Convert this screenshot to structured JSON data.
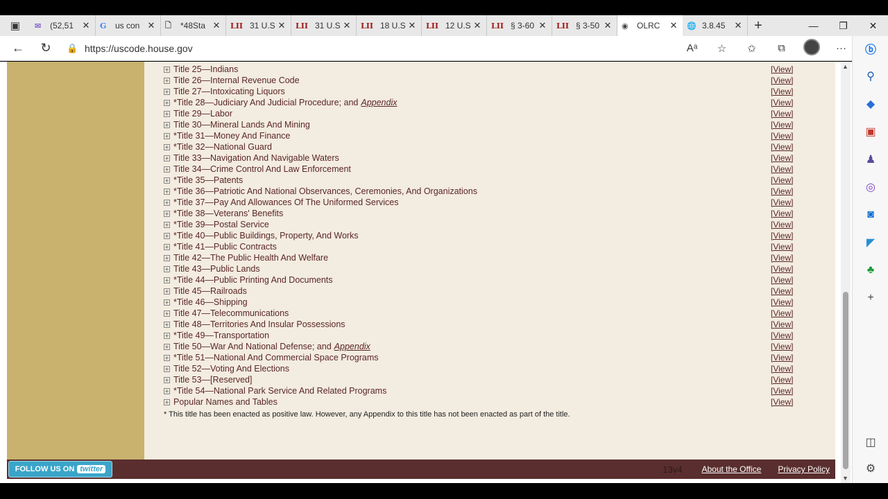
{
  "browser": {
    "tabs": [
      {
        "icon": "✉",
        "title": "(52,51",
        "kind": "mail"
      },
      {
        "icon": "G",
        "title": "us con",
        "kind": "google"
      },
      {
        "icon": "🗋",
        "title": "*48Sta",
        "kind": "doc"
      },
      {
        "icon": "LII",
        "title": "31 U.S",
        "kind": "lii"
      },
      {
        "icon": "LII",
        "title": "31 U.S",
        "kind": "lii"
      },
      {
        "icon": "LII",
        "title": "18 U.S",
        "kind": "lii"
      },
      {
        "icon": "LII",
        "title": "12 U.S",
        "kind": "lii"
      },
      {
        "icon": "LII",
        "title": "§ 3-60",
        "kind": "lii"
      },
      {
        "icon": "LII",
        "title": "§ 3-50",
        "kind": "lii"
      },
      {
        "icon": "◉",
        "title": "OLRC",
        "kind": "active"
      },
      {
        "icon": "🌐",
        "title": "3.8.45",
        "kind": "web"
      }
    ],
    "new_tab": "+",
    "url": "https://uscode.house.gov"
  },
  "titles": [
    {
      "name": "Title 25—Indians",
      "view": "[View]"
    },
    {
      "name": "Title 26—Internal Revenue Code",
      "view": "[View]"
    },
    {
      "name": "Title 27—Intoxicating Liquors",
      "view": "[View]"
    },
    {
      "name": "*Title 28—Judiciary And Judicial Procedure; and",
      "appendix": "Appendix",
      "view": "[View]"
    },
    {
      "name": "Title 29—Labor",
      "view": "[View]"
    },
    {
      "name": "Title 30—Mineral Lands And Mining",
      "view": "[View]"
    },
    {
      "name": "*Title 31—Money And Finance",
      "view": "[View]"
    },
    {
      "name": "*Title 32—National Guard",
      "view": "[View]"
    },
    {
      "name": "Title 33—Navigation And Navigable Waters",
      "view": "[View]"
    },
    {
      "name": "Title 34—Crime Control And Law Enforcement",
      "view": "[View]"
    },
    {
      "name": "*Title 35—Patents",
      "view": "[View]"
    },
    {
      "name": "*Title 36—Patriotic And National Observances, Ceremonies, And Organizations",
      "view": "[View]"
    },
    {
      "name": "*Title 37—Pay And Allowances Of The Uniformed Services",
      "view": "[View]"
    },
    {
      "name": "*Title 38—Veterans' Benefits",
      "view": "[View]"
    },
    {
      "name": "*Title 39—Postal Service",
      "view": "[View]"
    },
    {
      "name": "*Title 40—Public Buildings, Property, And Works",
      "view": "[View]"
    },
    {
      "name": "*Title 41—Public Contracts",
      "view": "[View]"
    },
    {
      "name": "Title 42—The Public Health And Welfare",
      "view": "[View]"
    },
    {
      "name": "Title 43—Public Lands",
      "view": "[View]"
    },
    {
      "name": "*Title 44—Public Printing And Documents",
      "view": "[View]"
    },
    {
      "name": "Title 45—Railroads",
      "view": "[View]"
    },
    {
      "name": "*Title 46—Shipping",
      "view": "[View]"
    },
    {
      "name": "Title 47—Telecommunications",
      "view": "[View]"
    },
    {
      "name": "Title 48—Territories And Insular Possessions",
      "view": "[View]"
    },
    {
      "name": "*Title 49—Transportation",
      "view": "[View]"
    },
    {
      "name": "Title 50—War And National Defense; and",
      "appendix": "Appendix",
      "view": "[View]"
    },
    {
      "name": "*Title 51—National And Commercial Space Programs",
      "view": "[View]"
    },
    {
      "name": "Title 52—Voting And Elections",
      "view": "[View]"
    },
    {
      "name": "Title 53—[Reserved]",
      "view": "[View]"
    },
    {
      "name": "*Title 54—National Park Service And Related Programs",
      "view": "[View]"
    },
    {
      "name": " Popular Names and Tables",
      "view": "[View]"
    }
  ],
  "footnote": "* This title has been enacted as positive law. However, any Appendix to this title has not been enacted as part of the title.",
  "footer": {
    "follow_label": "FOLLOW US ON",
    "twitter_label": "twitter",
    "version": "13v4",
    "about": "About the Office",
    "privacy": "Privacy Policy"
  },
  "colors": {
    "left_column": "#c8b26e",
    "main_bg": "#f3ece0",
    "footer_bg": "#5a2e2e",
    "link": "#5a2626"
  }
}
